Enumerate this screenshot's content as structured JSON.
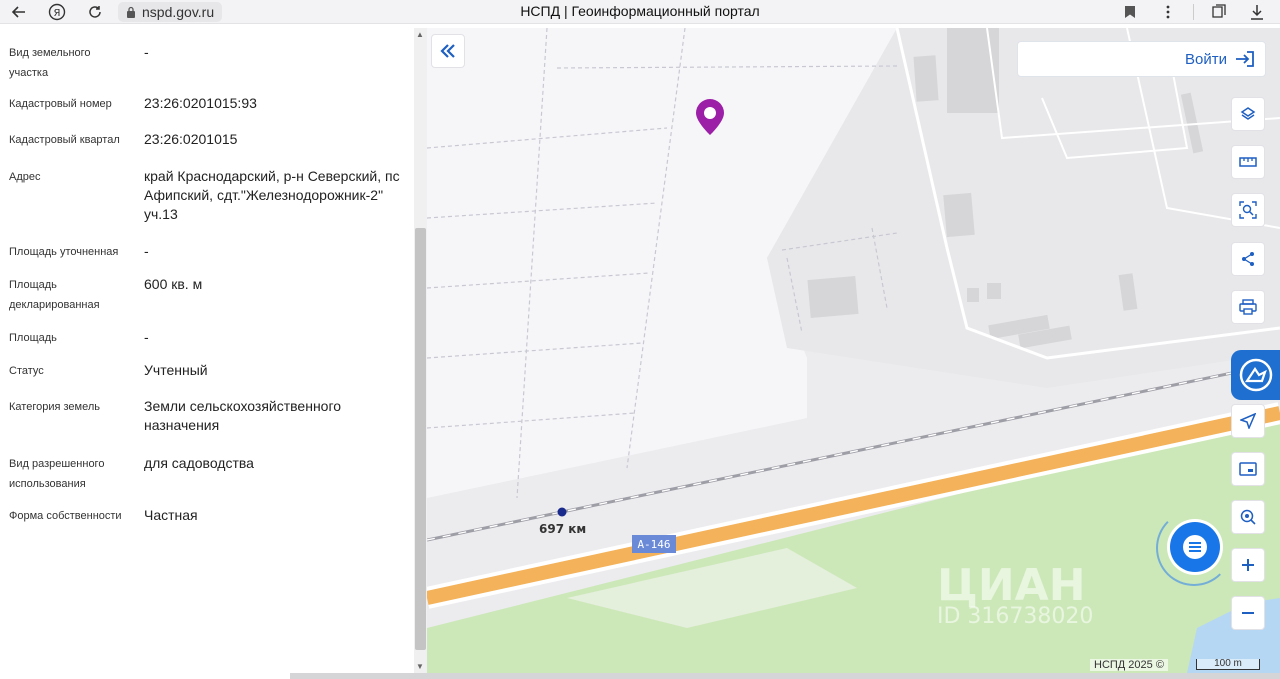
{
  "browser": {
    "url": "nspd.gov.ru",
    "title": "НСПД | Геоинформационный портал"
  },
  "parcel": {
    "fields": [
      {
        "label": "Вид земельного участка",
        "value": "-"
      },
      {
        "label": "Кадастровый номер",
        "value": "23:26:0201015:93"
      },
      {
        "label": "Кадастровый квартал",
        "value": "23:26:0201015"
      },
      {
        "label": "Адрес",
        "value": "край Краснодарский, р-н Северский, пс Афипский, сдт.\"Железнодорожник-2\" уч.13"
      },
      {
        "label": "Площадь уточненная",
        "value": "-"
      },
      {
        "label": "Площадь декларированная",
        "value": "600 кв. м"
      },
      {
        "label": "Площадь",
        "value": "-"
      },
      {
        "label": "Статус",
        "value": "Учтенный"
      },
      {
        "label": "Категория земель",
        "value": "Земли сельскохозяйственного назначения"
      },
      {
        "label": "Вид разрешенного использования",
        "value": "для садоводства"
      },
      {
        "label": "Форма собственности",
        "value": "Частная"
      }
    ]
  },
  "map": {
    "login_label": "Войти",
    "km_label": "697 км",
    "road_label": "А-146",
    "watermark": "ЦИАН",
    "watermark_id": "ID 316738020",
    "copyright": "НСПД 2025 ©",
    "scale_label": "100 m",
    "tools": [
      "layers-icon",
      "ruler-icon",
      "area-select-icon",
      "share-icon",
      "print-icon",
      "geolocation-icon",
      "minimap-icon",
      "search-location-icon",
      "zoom-in-icon",
      "zoom-out-icon"
    ]
  },
  "colors": {
    "accent": "#1e5fc2",
    "marker": "#9c1fa8",
    "road": "#f6b45a",
    "green": "#c9e7b4"
  }
}
